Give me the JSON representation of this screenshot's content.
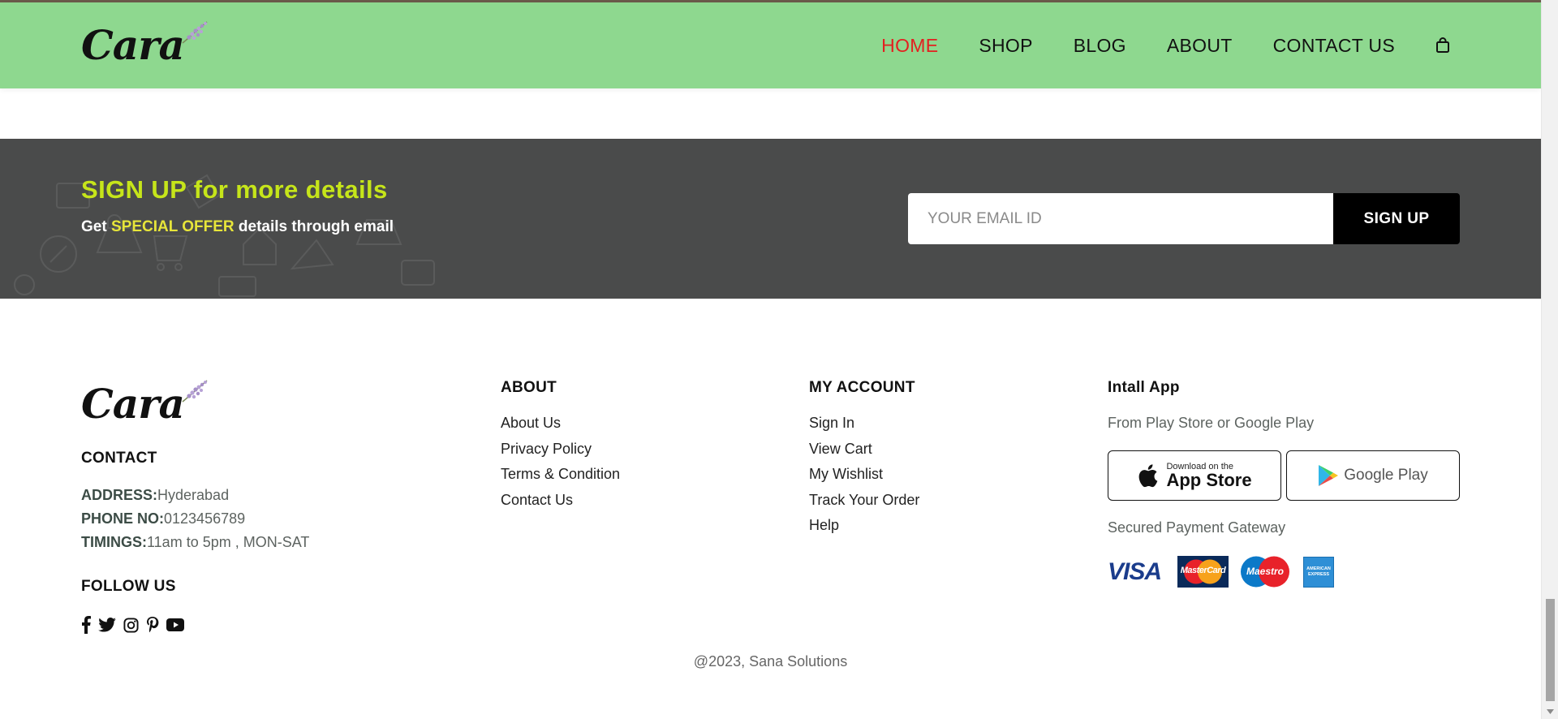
{
  "brand": {
    "logo_text": "Cara"
  },
  "nav": {
    "items": [
      {
        "label": "HOME",
        "active": true
      },
      {
        "label": "SHOP",
        "active": false
      },
      {
        "label": "BLOG",
        "active": false
      },
      {
        "label": "ABOUT",
        "active": false
      },
      {
        "label": "CONTACT US",
        "active": false
      }
    ],
    "cart_icon": "shopping-bag-icon"
  },
  "newsletter": {
    "title": "SIGN UP for more details",
    "subtitle_prefix": "Get",
    "subtitle_highlight": "SPECIAL OFFER",
    "subtitle_suffix": "details through email",
    "email_placeholder": "YOUR EMAIL ID",
    "email_value": "",
    "button_label": "SIGN UP"
  },
  "footer": {
    "contact": {
      "heading": "CONTACT",
      "address_label": "ADDRESS:",
      "address_value": "Hyderabad",
      "phone_label": "PHONE NO:",
      "phone_value": "0123456789",
      "timings_label": "TIMINGS:",
      "timings_value": "11am to 5pm , MON-SAT"
    },
    "follow": {
      "heading": "FOLLOW US",
      "icons": [
        "facebook-icon",
        "twitter-icon",
        "instagram-icon",
        "pinterest-icon",
        "youtube-icon"
      ]
    },
    "about": {
      "heading": "ABOUT",
      "links": [
        "About Us",
        "Privacy Policy",
        "Terms & Condition",
        "Contact Us"
      ]
    },
    "account": {
      "heading": "MY ACCOUNT",
      "links": [
        "Sign In",
        "View Cart",
        "My Wishlist",
        "Track Your Order",
        "Help"
      ]
    },
    "install": {
      "heading": "Intall App",
      "subtitle": "From Play Store or Google Play",
      "app_store_small": "Download on the",
      "app_store_big": "App Store",
      "google_play": "Google Play",
      "payment_heading": "Secured Payment Gateway",
      "payment_visa": "VISA",
      "payment_mastercard": "MasterCard",
      "payment_maestro": "Maestro",
      "payment_amex": "AMERICAN EXPRESS"
    },
    "copyright": "@2023, Sana Solutions"
  },
  "colors": {
    "header_bg": "#8ed88f",
    "nav_active": "#e32020",
    "newsletter_bg": "#4a4b4b",
    "newsletter_title": "#c6e51a",
    "newsletter_highlight": "#e7e53a"
  }
}
